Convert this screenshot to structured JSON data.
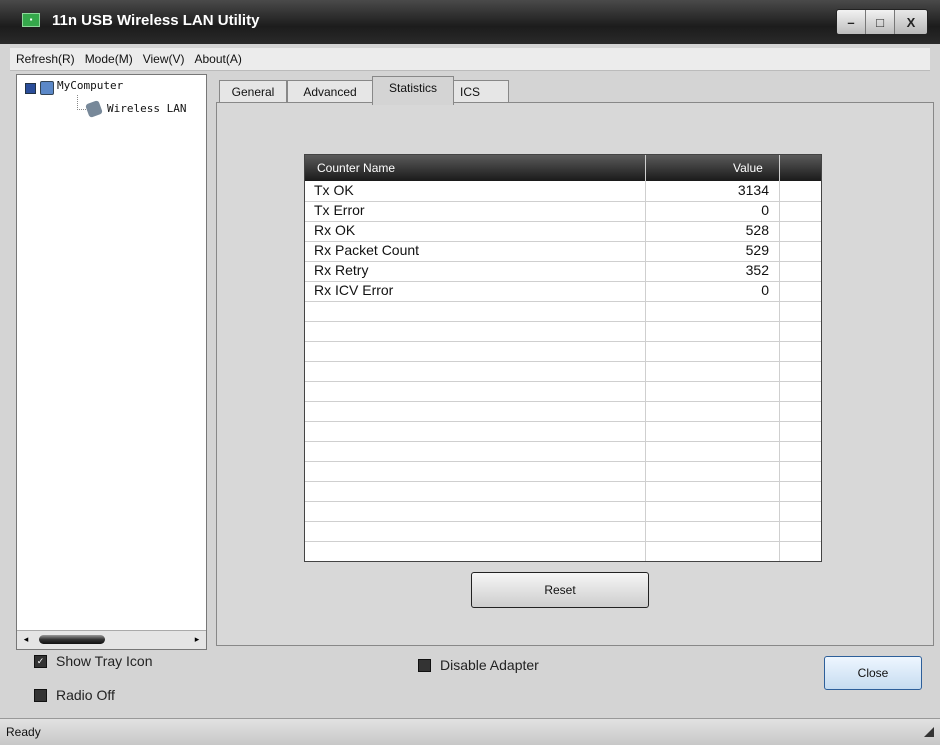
{
  "window": {
    "title": "11n USB Wireless LAN Utility",
    "minimize": "–",
    "maximize": "□",
    "close": "X"
  },
  "menu": [
    "Refresh(R)",
    "Mode(M)",
    "View(V)",
    "About(A)"
  ],
  "tree": {
    "root": "MyComputer",
    "child": "Wireless LAN"
  },
  "tabs": [
    "General",
    "Advanced",
    "Statistics",
    "ICS"
  ],
  "active_tab": "Statistics",
  "table": {
    "headers": {
      "name": "Counter Name",
      "value": "Value"
    },
    "rows": [
      {
        "name": "Tx OK",
        "value": "3134"
      },
      {
        "name": "Tx Error",
        "value": "0"
      },
      {
        "name": "Rx OK",
        "value": "528"
      },
      {
        "name": "Rx Packet Count",
        "value": "529"
      },
      {
        "name": "Rx Retry",
        "value": "352"
      },
      {
        "name": "Rx ICV Error",
        "value": "0"
      }
    ]
  },
  "reset_label": "Reset",
  "options": {
    "show_tray_icon": {
      "label": "Show Tray Icon",
      "checked": true
    },
    "radio_off": {
      "label": "Radio Off",
      "checked": false
    },
    "disable_adapter": {
      "label": "Disable Adapter",
      "checked": false
    }
  },
  "close_label": "Close",
  "status": "Ready"
}
